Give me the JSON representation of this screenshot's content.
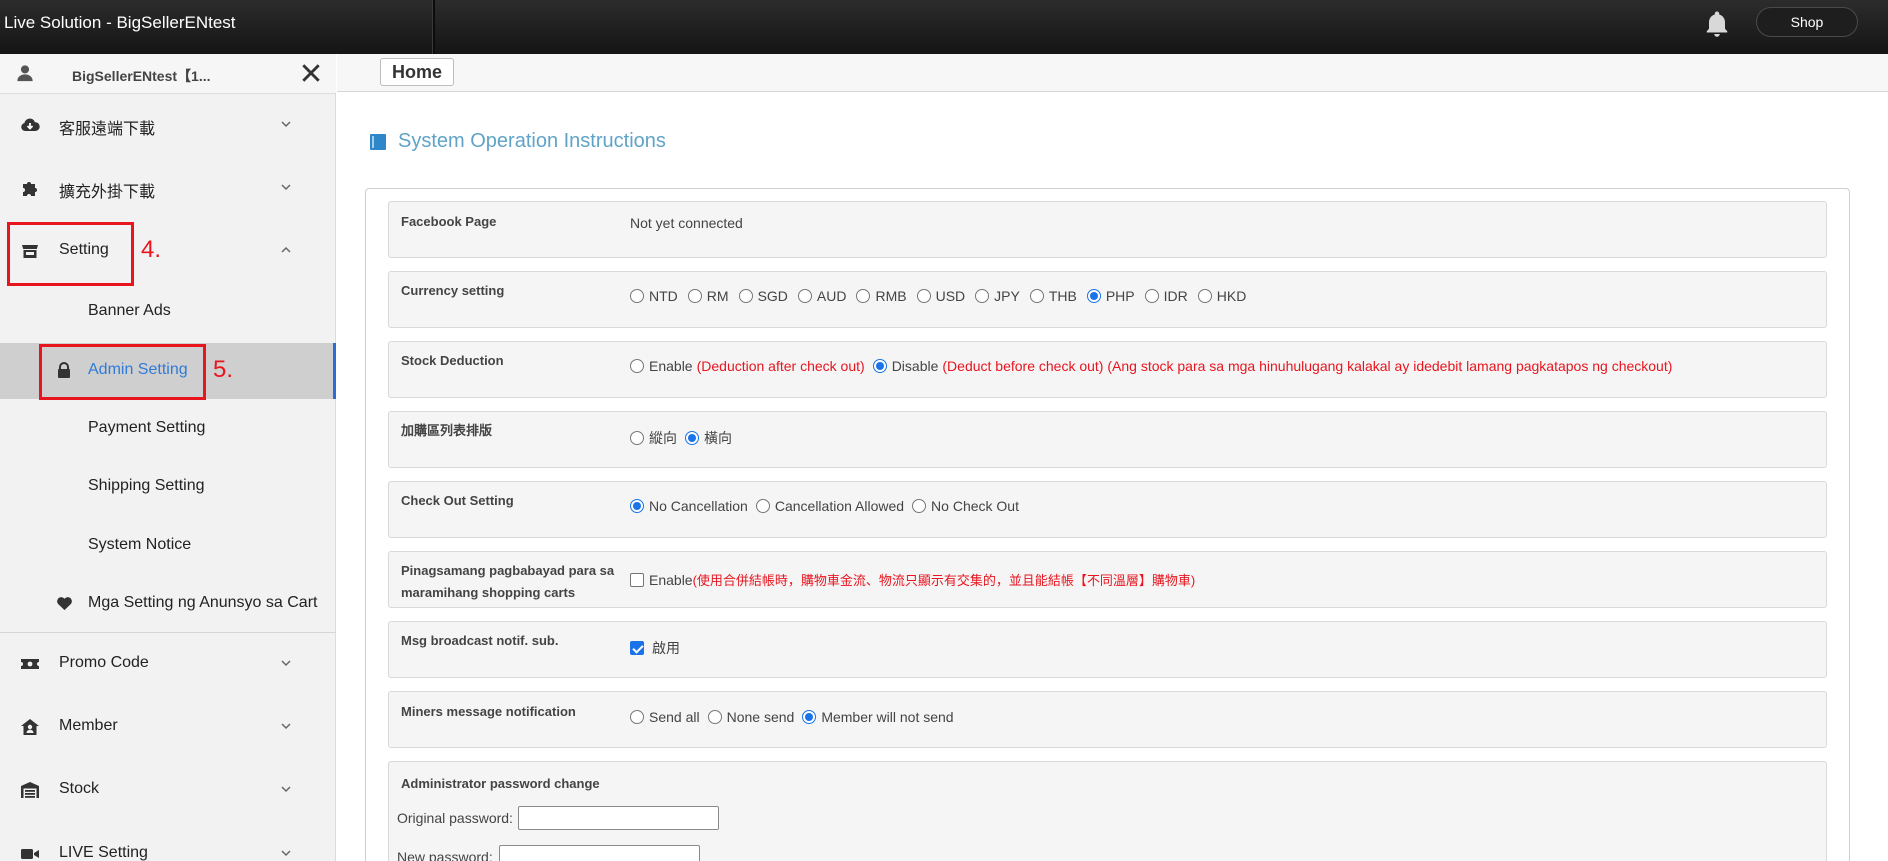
{
  "app": {
    "title": "Live Solution - BigSellerENtest",
    "shop_label": "Shop",
    "bell_icon": "bell-icon"
  },
  "sidebar": {
    "user": {
      "name": "BigSellerENtest【1...",
      "icon": "user-icon",
      "close_icon": "close-icon"
    },
    "items": [
      {
        "label": "客服遠端下載",
        "icon": "cloud-download-icon"
      },
      {
        "label": "擴充外掛下載",
        "icon": "puzzle-icon"
      },
      {
        "label": "Setting",
        "icon": "store-icon"
      },
      {
        "label": "Promo Code",
        "icon": "ticket-icon"
      },
      {
        "label": "Member",
        "icon": "member-icon"
      },
      {
        "label": "Stock",
        "icon": "warehouse-icon"
      },
      {
        "label": "LIVE Setting",
        "icon": "video-icon"
      }
    ],
    "sub_items": [
      {
        "label": "Banner Ads"
      },
      {
        "label": "Admin Setting",
        "icon": "lock-icon"
      },
      {
        "label": "Payment Setting"
      },
      {
        "label": "Shipping Setting"
      },
      {
        "label": "System Notice"
      },
      {
        "label": "Mga Setting ng Anunsyo sa Cart",
        "icon": "heart-icon"
      }
    ],
    "annotations": {
      "step4": "4.",
      "step5": "5."
    }
  },
  "main": {
    "tab": "Home",
    "section_title": "System Operation Instructions",
    "rows": {
      "facebook": {
        "label": "Facebook Page",
        "value": "Not yet connected"
      },
      "currency": {
        "label": "Currency setting",
        "options": [
          "NTD",
          "RM",
          "SGD",
          "AUD",
          "RMB",
          "USD",
          "JPY",
          "THB",
          "PHP",
          "IDR",
          "HKD"
        ],
        "selected": "PHP"
      },
      "stock": {
        "label": "Stock Deduction",
        "enable": "Enable",
        "enable_note": "(Deduction after check out)",
        "disable": "Disable",
        "disable_note": "(Deduct before check out) (Ang stock para sa mga hinuhulugang kalakal ay idedebit lamang pagkatapos ng checkout)"
      },
      "layout": {
        "label": "加購區列表排版",
        "opt1": "縱向",
        "opt2": "橫向"
      },
      "checkout": {
        "label": "Check Out Setting",
        "opt1": "No Cancellation",
        "opt2": "Cancellation Allowed",
        "opt3": "No Check Out"
      },
      "combined": {
        "label_line1": "Pinagsamang pagbabayad para sa",
        "label_line2": "maramihang shopping carts",
        "enable": "Enable",
        "note": "(使用合併結帳時，購物車金流、物流只顯示有交集的，並且能結帳【不同溫層】購物車)"
      },
      "broadcast": {
        "label": "Msg broadcast notif. sub.",
        "enable": "啟用"
      },
      "miners": {
        "label": "Miners message notification",
        "opt1": "Send all",
        "opt2": "None send",
        "opt3": "Member will not send"
      },
      "password": {
        "label": "Administrator password change",
        "original": "Original password:",
        "new": "New password:"
      }
    }
  }
}
